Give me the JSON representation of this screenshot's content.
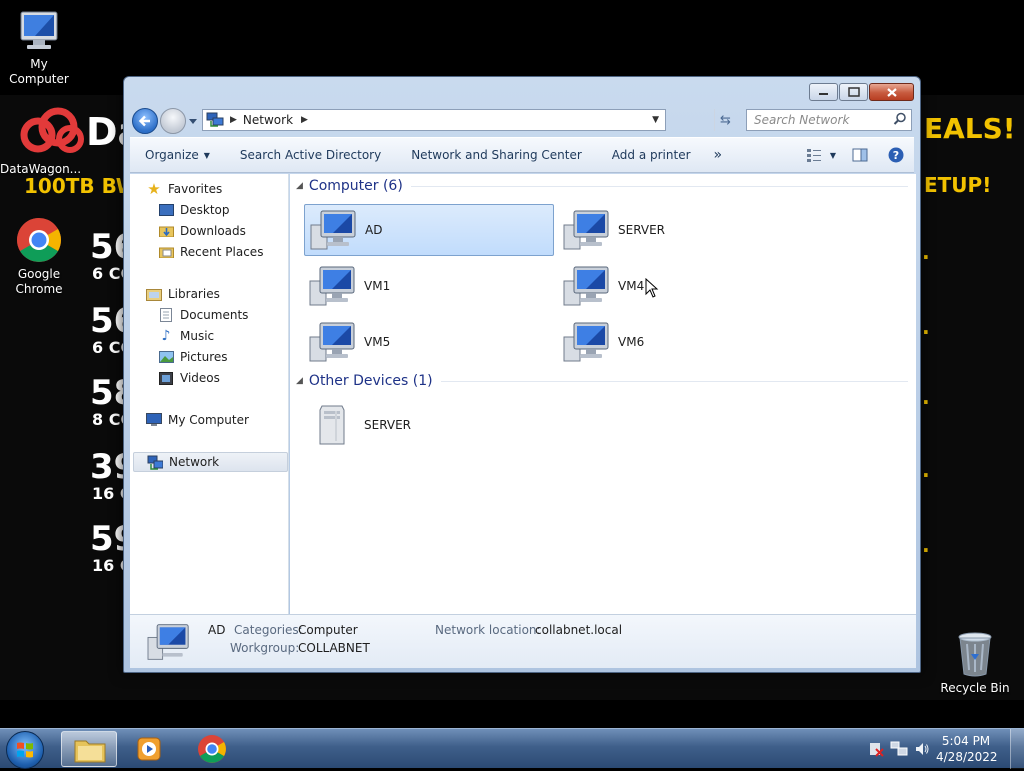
{
  "desktop": {
    "icons": [
      {
        "label": "My Computer"
      },
      {
        "label": "DataWagon..."
      },
      {
        "label": "Google Chrome"
      },
      {
        "label": "Recycle Bin"
      }
    ],
    "wallpaper": {
      "brand": "Da",
      "banner": "100TB BW",
      "right_top": "EALS!",
      "right_second": "ETUP!",
      "numbers": [
        "56",
        "56",
        "58",
        "39",
        "59"
      ],
      "subs": [
        "6 CC",
        "6 CC",
        "8 CC",
        "16 C",
        "16 C"
      ],
      "right_dots": [
        ".",
        ".",
        ".",
        ".",
        ".",
        "."
      ]
    }
  },
  "window": {
    "address": {
      "crumb": "Network"
    },
    "search": {
      "placeholder": "Search Network"
    },
    "toolbar": {
      "organize": "Organize",
      "search_ad": "Search Active Directory",
      "network_sharing": "Network and Sharing Center",
      "add_printer": "Add a printer",
      "more": "»"
    },
    "nav": {
      "favorites": "Favorites",
      "desktop": "Desktop",
      "downloads": "Downloads",
      "recent": "Recent Places",
      "libraries": "Libraries",
      "documents": "Documents",
      "music": "Music",
      "pictures": "Pictures",
      "videos": "Videos",
      "my_computer": "My Computer",
      "network": "Network"
    },
    "groups": {
      "computer": {
        "title": "Computer (6)",
        "items": [
          "AD",
          "SERVER",
          "VM1",
          "VM4",
          "VM5",
          "VM6"
        ]
      },
      "other": {
        "title": "Other Devices (1)",
        "items": [
          "SERVER"
        ]
      }
    },
    "details": {
      "name": "AD",
      "categories_label": "Categories:",
      "categories_value": "Computer",
      "workgroup_label": "Workgroup:",
      "workgroup_value": "COLLABNET",
      "location_label": "Network location:",
      "location_value": "collabnet.local"
    }
  },
  "taskbar": {
    "time": "5:04 PM",
    "date": "4/28/2022"
  },
  "colors": {
    "accent": "#1e3287",
    "wallpaper_yellow": "#f2c200",
    "selection": "#c1dcfc"
  }
}
